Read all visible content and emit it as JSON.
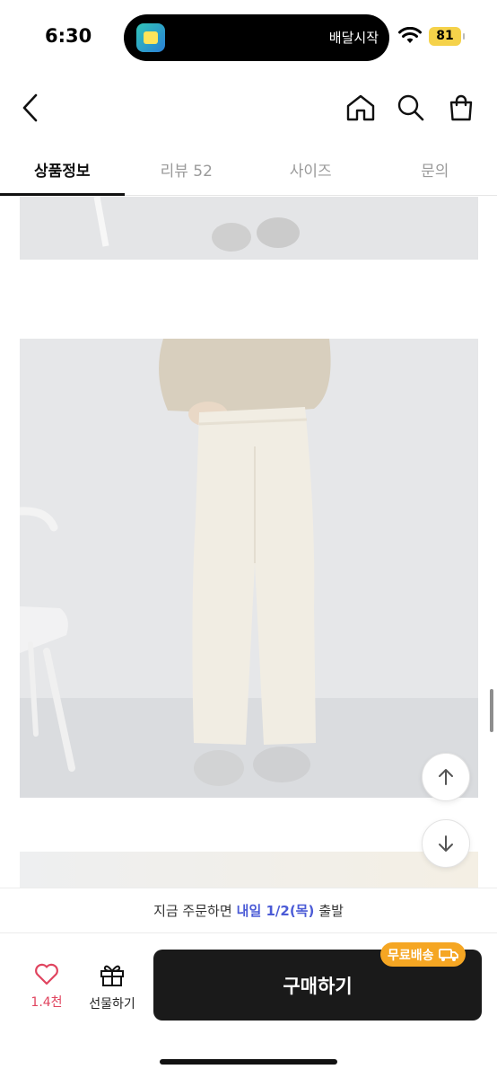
{
  "status_bar": {
    "time": "6:30",
    "island_text": "배달시작",
    "battery": "81"
  },
  "nav": {
    "icons": [
      "chevron-left-icon",
      "home-icon",
      "search-icon",
      "shopping-bag-icon"
    ]
  },
  "tabs": [
    {
      "label": "상품정보",
      "active": true
    },
    {
      "label": "리뷰 52",
      "active": false
    },
    {
      "label": "사이즈",
      "active": false
    },
    {
      "label": "문의",
      "active": false
    }
  ],
  "floating_buttons": {
    "up_icon": "arrow-up-icon",
    "down_icon": "arrow-down-icon"
  },
  "bottom_bar": {
    "delivery_prefix": "지금 주문하면",
    "delivery_highlight": "내일 1/2(목)",
    "delivery_suffix": "출발",
    "like_count": "1.4천",
    "gift_label": "선물하기",
    "buy_label": "구매하기",
    "free_shipping_badge": "무료배송"
  },
  "colors": {
    "accent_blue": "#4b5bd6",
    "like_red": "#e0445f",
    "badge_orange": "#f5a623",
    "buy_button": "#1a1a1a"
  }
}
